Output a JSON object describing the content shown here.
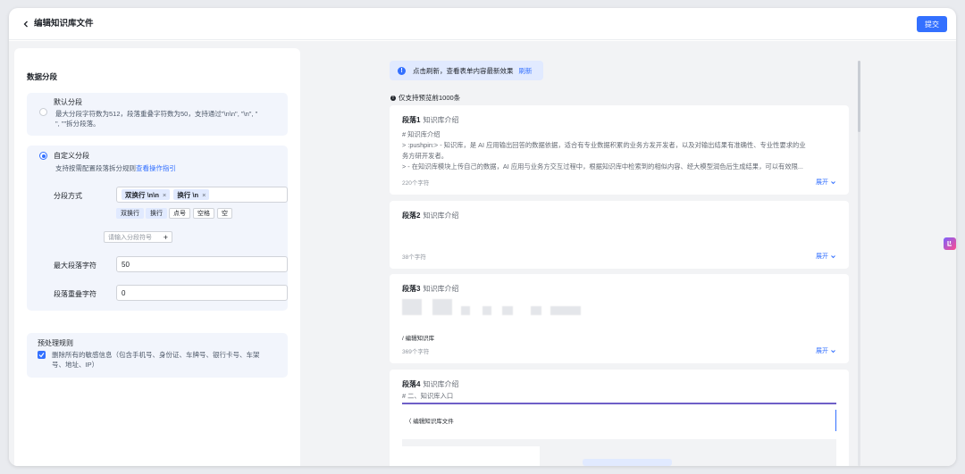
{
  "header": {
    "title": "编辑知识库文件",
    "submit_label": "提交"
  },
  "left": {
    "section_title": "数据分段",
    "default_option": {
      "title": "默认分段",
      "desc_line1": "最大分段字符数为512，段落重叠字符数为50，支持通过\"\\n\\n\", \"\\n\", \"",
      "desc_line2": "\", \"\"拆分段落。"
    },
    "custom_option": {
      "title": "自定义分段",
      "desc": "支持按需配置段落拆分规则",
      "guide_link": "查看操作指引",
      "split_label": "分段方式",
      "selected_tags": [
        "双换行 \\n\\n",
        "换行 \\n"
      ],
      "chips": [
        "双换行",
        "换行",
        "点号",
        "空格",
        "空"
      ],
      "separator_placeholder": "请输入分段符号",
      "max_label": "最大段落字符",
      "max_value": "50",
      "overlap_label": "段落重叠字符",
      "overlap_value": "0"
    },
    "preprocess": {
      "title": "预处理规则",
      "rule_line1": "删除所有的敏感信息（包含手机号、身份证、车牌号、银行卡号、车架",
      "rule_line2": "号、地址、IP）"
    }
  },
  "right": {
    "notice_text": "点击刷新，查看表单内容最新效果",
    "notice_link": "刷新",
    "preview_note": "仅支持预览前1000条",
    "expand_label": "展开",
    "segments": [
      {
        "name": "段落1",
        "subtitle": "知识库介绍",
        "lines": [
          "# 知识库介绍",
          "> :pushpin:> - 知识库，是 AI 应用输出回答的数据依据，适合有专业数据积累的业务方发开发者，以及对输出结果有准确性、专业性要求的业",
          "务方研开发者。",
          "> - 在知识库模块上传自己的数据，AI 应用与业务方交互过程中，根据知识库中检索到的相似内容、经大模型润色后生成结果，可以有效限..."
        ],
        "count": "220个字符"
      },
      {
        "name": "段落2",
        "subtitle": "知识库介绍",
        "lines": [],
        "count": "38个字符"
      },
      {
        "name": "段落3",
        "subtitle": "知识库介绍",
        "lines": [
          "/ 编辑知识库"
        ],
        "count": "369个字符"
      },
      {
        "name": "段落4",
        "subtitle": "知识库介绍",
        "lines": [
          "# 二、知识库入口",
          "〈 编辑知识库文件"
        ],
        "count": ""
      }
    ]
  }
}
